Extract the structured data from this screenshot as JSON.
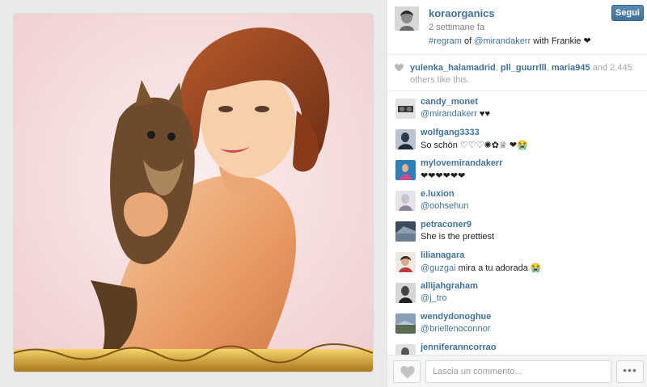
{
  "post": {
    "owner": "koraorganics",
    "time": "2 settimane fa",
    "caption_tag": "#regram",
    "caption_of": "of",
    "caption_mention": "@mirandakerr",
    "caption_rest": "with Frankie ❤",
    "follow_label": "Segui"
  },
  "likes": {
    "likers": [
      "yulenka_halamadrid",
      "pll_guurrlll",
      "maria945"
    ],
    "and_text": "and",
    "count": "2,445",
    "suffix": "others like this."
  },
  "comments": [
    {
      "user": "candy_monet",
      "mention": "@mirandakerr",
      "text": "♥♥"
    },
    {
      "user": "wolfgang3333",
      "mention": "",
      "text": "So schön ♡♡♡✺✿♕ ❤😭"
    },
    {
      "user": "mylovemirandakerr",
      "mention": "",
      "text": "❤❤❤❤❤❤"
    },
    {
      "user": "e.luxion",
      "mention": "@oohsehun",
      "text": ""
    },
    {
      "user": "petraconer9",
      "mention": "",
      "text": "She is the prettiest"
    },
    {
      "user": "lilianagara",
      "mention": "@guzgai",
      "text": "mira a tu adorada 😭"
    },
    {
      "user": "allijahgraham",
      "mention": "@j_tro",
      "text": ""
    },
    {
      "user": "wendydonoghue",
      "mention": "@briellenoconnor",
      "text": ""
    },
    {
      "user": "jenniferanncorrao",
      "mention": "",
      "text": ""
    }
  ],
  "footer": {
    "comment_placeholder": "Lascia un commento...",
    "more_label": "•••"
  },
  "icons": {
    "like": "heart-icon",
    "more": "ellipsis-icon"
  },
  "colors": {
    "link": "#3f729b",
    "follow_button": "#3f729b",
    "photo_background": "#f3dcdc"
  }
}
